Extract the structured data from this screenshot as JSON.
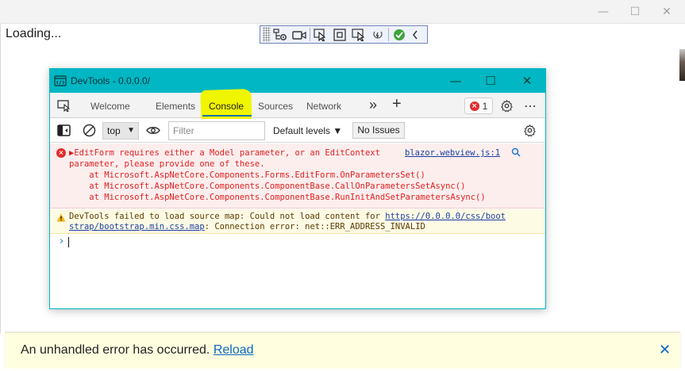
{
  "page": {
    "loading_text": "Loading...",
    "error_bar": {
      "message": "An unhandled error has occurred.",
      "reload_label": "Reload",
      "close_glyph": "✕"
    }
  },
  "outer_window": {
    "minimize_glyph": "—",
    "maximize_glyph": "☐",
    "close_glyph": "✕"
  },
  "devtools": {
    "title": "DevTools - 0.0.0.0/",
    "window_controls": {
      "minimize": "—",
      "maximize": "☐",
      "close": "✕"
    },
    "tabs": {
      "welcome": "Welcome",
      "elements": "Elements",
      "console": "Console",
      "sources": "Sources",
      "network": "Network",
      "more": "»",
      "add": "+"
    },
    "error_count": "1",
    "more_menu": "⋯",
    "console_toolbar": {
      "context": "top",
      "filter_placeholder": "Filter",
      "levels": "Default levels ▼",
      "issues": "No Issues"
    },
    "messages": {
      "error": {
        "line1": "▶EditForm requires either a Model parameter, or an EditContext",
        "line2": "parameter, please provide one of these.",
        "line3": "    at Microsoft.AspNetCore.Components.Forms.EditForm.OnParametersSet()",
        "line4": "    at Microsoft.AspNetCore.Components.ComponentBase.CallOnParametersSetAsync()",
        "line5": "    at Microsoft.AspNetCore.Components.ComponentBase.RunInitAndSetParametersAsync()",
        "source": "blazor.webview.js:1"
      },
      "warning": {
        "line1_prefix": "DevTools failed to load source map: Could not load content for ",
        "line1_link": "https://0.0.0.0/css/boot",
        "line2_link": "strap/bootstrap.min.css.map",
        "line2_suffix": ": Connection error: net::ERR_ADDRESS_INVALID"
      }
    },
    "prompt": "›"
  },
  "colors": {
    "devtools_accent": "#00b7c3",
    "console_highlight": "#f0f500",
    "error_text": "#e01f1f",
    "link": "#0a66c2"
  }
}
